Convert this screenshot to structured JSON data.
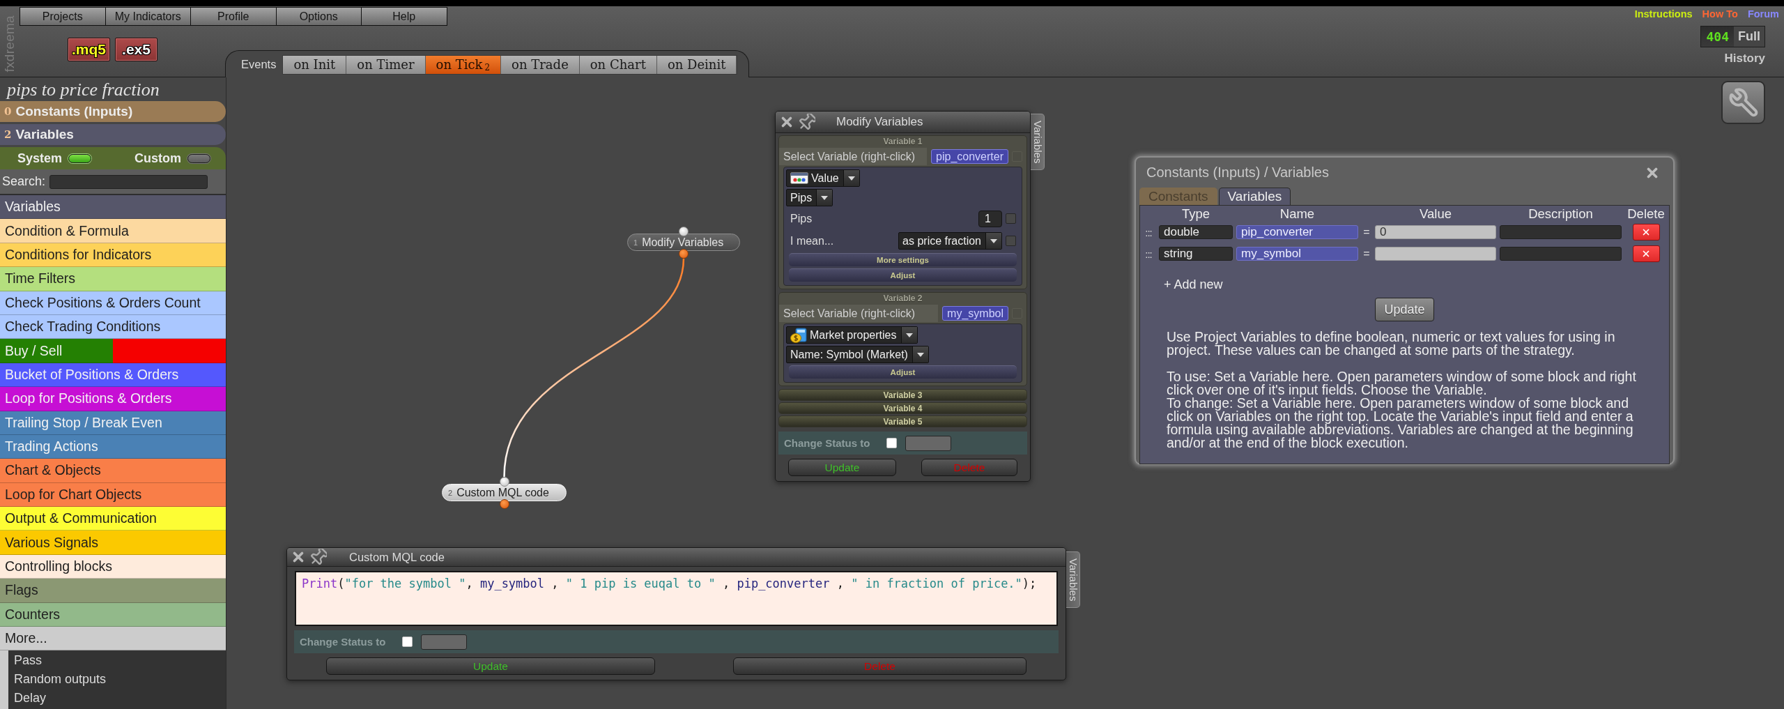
{
  "brand": "fxdreema",
  "menu": [
    "Projects",
    "My Indicators",
    "Profile",
    "Options",
    "Help"
  ],
  "exports": [
    {
      "label": ".mq5",
      "kind": "source"
    },
    {
      "label": ".ex5",
      "kind": "compiled"
    }
  ],
  "events": {
    "label": "Events",
    "tabs": [
      {
        "label": "on Init",
        "selected": false
      },
      {
        "label": "on Timer",
        "selected": false
      },
      {
        "label": "on Tick",
        "count": "2",
        "selected": true
      },
      {
        "label": "on Trade",
        "selected": false
      },
      {
        "label": "on Chart",
        "selected": false
      },
      {
        "label": "on Deinit",
        "selected": false
      }
    ]
  },
  "links": [
    {
      "label": "Instructions",
      "color": "#ccee11"
    },
    {
      "label": "How To",
      "color": "#ff6633"
    },
    {
      "label": "Forum",
      "color": "#8888ff"
    }
  ],
  "counter": {
    "value": "404",
    "label": "Full"
  },
  "history": "History",
  "project_title": "pips to price fraction",
  "sidebar": {
    "sections": [
      {
        "count": "0",
        "label": "Constants (Inputs)",
        "color": "#9a7b55"
      },
      {
        "count": "2",
        "label": "Variables",
        "color": "#56566a"
      }
    ],
    "toggles": [
      {
        "label": "System",
        "on": true
      },
      {
        "label": "Custom",
        "on": false
      }
    ],
    "search": {
      "label": "Search:"
    },
    "categories": [
      {
        "label": "Variables",
        "color": "#56566a"
      },
      {
        "label": "Condition & Formula",
        "color": "#fcd9a0"
      },
      {
        "label": "Conditions for Indicators",
        "color": "#fdd258"
      },
      {
        "label": "Time Filters",
        "color": "#b4df7e"
      },
      {
        "label": "Check Positions & Orders Count",
        "color": "#aac7ff"
      },
      {
        "label": "Check Trading Conditions",
        "color": "#aac7ff"
      },
      {
        "label": "Buy / Sell",
        "color": "#248003",
        "segments": [
          {
            "color": "#f50000"
          }
        ]
      },
      {
        "label": "Bucket of Positions & Orders",
        "color": "#5458fd"
      },
      {
        "label": "Loop for Positions & Orders",
        "color": "#c60fd4"
      },
      {
        "label": "Trailing Stop / Break Even",
        "color": "#4a81b5"
      },
      {
        "label": "Trading Actions",
        "color": "#4a81b5"
      },
      {
        "label": "Chart & Objects",
        "color": "#f97e48"
      },
      {
        "label": "Loop for Chart Objects",
        "color": "#f97e48"
      },
      {
        "label": "Output & Communication",
        "color": "#fdfd34"
      },
      {
        "label": "Various Signals",
        "color": "#fbc900"
      },
      {
        "label": "Controlling blocks",
        "color": "#feebdc"
      },
      {
        "label": "Flags",
        "color": "#8b9873"
      },
      {
        "label": "Counters",
        "color": "#92b98a"
      }
    ],
    "more": {
      "label": "More...",
      "expanded": true,
      "items": [
        "Pass",
        "Random outputs",
        "Delay"
      ]
    }
  },
  "canvas": {
    "nodes": [
      {
        "number": "1",
        "label": "Modify Variables",
        "selected": false
      },
      {
        "number": "2",
        "label": "Custom MQL code",
        "selected": true
      }
    ]
  },
  "modify_window": {
    "title": "Modify Variables",
    "side_tab": "Variables",
    "variables": [
      {
        "heading": "Variable 1",
        "expanded": true,
        "select_label": "Select Variable (right-click)",
        "variable": "pip_converter",
        "checked": false,
        "source": {
          "kind": "value",
          "label": "Value"
        },
        "option": "Pips",
        "params": [
          {
            "kind": "input",
            "label": "Pips",
            "value": "1",
            "checked": false
          },
          {
            "kind": "select",
            "label": "I mean...",
            "value": "as price fraction",
            "checked": false
          }
        ],
        "buttons": [
          "More settings",
          "Adjust"
        ]
      },
      {
        "heading": "Variable 2",
        "expanded": true,
        "select_label": "Select Variable (right-click)",
        "variable": "my_symbol",
        "checked": false,
        "source": {
          "kind": "market",
          "label": "Market properties"
        },
        "option": "Name: Symbol (Market)",
        "buttons": [
          "Adjust"
        ]
      },
      {
        "heading": "Variable 3",
        "expanded": false
      },
      {
        "heading": "Variable 4",
        "expanded": false
      },
      {
        "heading": "Variable 5",
        "expanded": false
      }
    ],
    "status": {
      "label": "Change Status to",
      "checked": false
    },
    "actions": [
      {
        "kind": "update",
        "label": "Update"
      },
      {
        "kind": "delete",
        "label": "Delete"
      }
    ]
  },
  "code_window": {
    "title": "Custom MQL code",
    "side_tab": "Variables",
    "code": [
      {
        "kind": "function",
        "text": "Print"
      },
      {
        "kind": "punct",
        "text": "("
      },
      {
        "kind": "string",
        "text": "\"for the symbol \""
      },
      {
        "kind": "punct",
        "text": ", "
      },
      {
        "kind": "ident",
        "text": "my_symbol"
      },
      {
        "kind": "punct",
        "text": " , "
      },
      {
        "kind": "string",
        "text": "\" 1 pip is euqal to \""
      },
      {
        "kind": "punct",
        "text": " , "
      },
      {
        "kind": "ident",
        "text": "pip_converter"
      },
      {
        "kind": "punct",
        "text": " , "
      },
      {
        "kind": "string",
        "text": "\" in fraction of price.\""
      },
      {
        "kind": "punct",
        "text": ");"
      }
    ],
    "status": {
      "label": "Change Status to",
      "checked": false
    },
    "actions": [
      {
        "kind": "update",
        "label": "Update"
      },
      {
        "kind": "delete",
        "label": "Delete"
      }
    ]
  },
  "variables_panel": {
    "title": "Constants (Inputs) / Variables",
    "tabs": [
      {
        "label": "Constants",
        "color": "#7d6a4e",
        "selected": false
      },
      {
        "label": "Variables",
        "color": "#555569",
        "selected": true
      }
    ],
    "columns": [
      "Type",
      "Name",
      "Value",
      "Description",
      "Delete"
    ],
    "rows": [
      {
        "handle": ":::",
        "type": "double",
        "name": "pip_converter",
        "operator": "=",
        "value": "0"
      },
      {
        "handle": ":::",
        "type": "string",
        "name": "my_symbol",
        "operator": "="
      }
    ],
    "add_new": "+ Add new",
    "update": "Update",
    "help": [
      [
        "Use Project Variables to define boolean, numeric or text values for using in project. These values can be changed at some parts of the strategy."
      ],
      [
        "To use: Set a Variable here. Open parameters window of some block and right click over one of it's input fields. Choose the Variable.",
        "To change: Set a Variable here. Open parameters window of some block and click on Variables on the right top. Locate the Variable's input field and enter a formula using available abbreviations. Variables are changed at the beginning and/or at the end of the block execution."
      ]
    ]
  }
}
